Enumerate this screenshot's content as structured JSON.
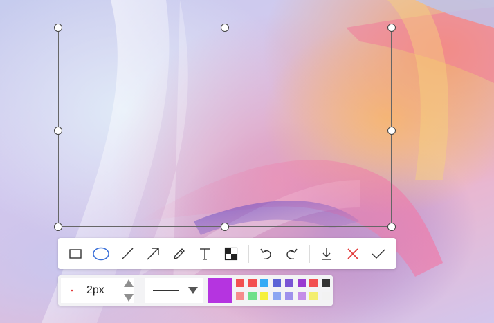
{
  "toolbar": {
    "tools": [
      {
        "name": "rectangle-tool",
        "icon": "rectangle-icon"
      },
      {
        "name": "ellipse-tool",
        "icon": "ellipse-icon",
        "active": true
      },
      {
        "name": "line-tool",
        "icon": "line-icon"
      },
      {
        "name": "arrow-tool",
        "icon": "arrow-icon"
      },
      {
        "name": "pen-tool",
        "icon": "pencil-icon"
      },
      {
        "name": "text-tool",
        "icon": "text-icon"
      },
      {
        "name": "mosaic-tool",
        "icon": "mosaic-icon"
      }
    ],
    "actions": [
      {
        "name": "undo-button",
        "icon": "undo-icon"
      },
      {
        "name": "redo-button",
        "icon": "redo-icon"
      },
      {
        "name": "save-button",
        "icon": "download-icon"
      },
      {
        "name": "cancel-button",
        "icon": "close-icon"
      },
      {
        "name": "confirm-button",
        "icon": "check-icon"
      }
    ],
    "accent_color": "#3a6fd8",
    "cancel_color": "#e23b3b"
  },
  "style": {
    "size_value": "2px",
    "dot_color": "#e23b3b",
    "current_color": "#b534e0",
    "palette_row1": [
      "#f25050",
      "#f25050",
      "#36aaf5",
      "#5c63d6",
      "#7a55d4",
      "#9a3bd0",
      "#f25050",
      "#333333"
    ],
    "palette_row2": [
      "#f58c8c",
      "#6fe08a",
      "#f5f03a",
      "#8ba6f2",
      "#9e91ec",
      "#c58de8",
      "#f3ee6e",
      "#f2f2f2"
    ]
  }
}
